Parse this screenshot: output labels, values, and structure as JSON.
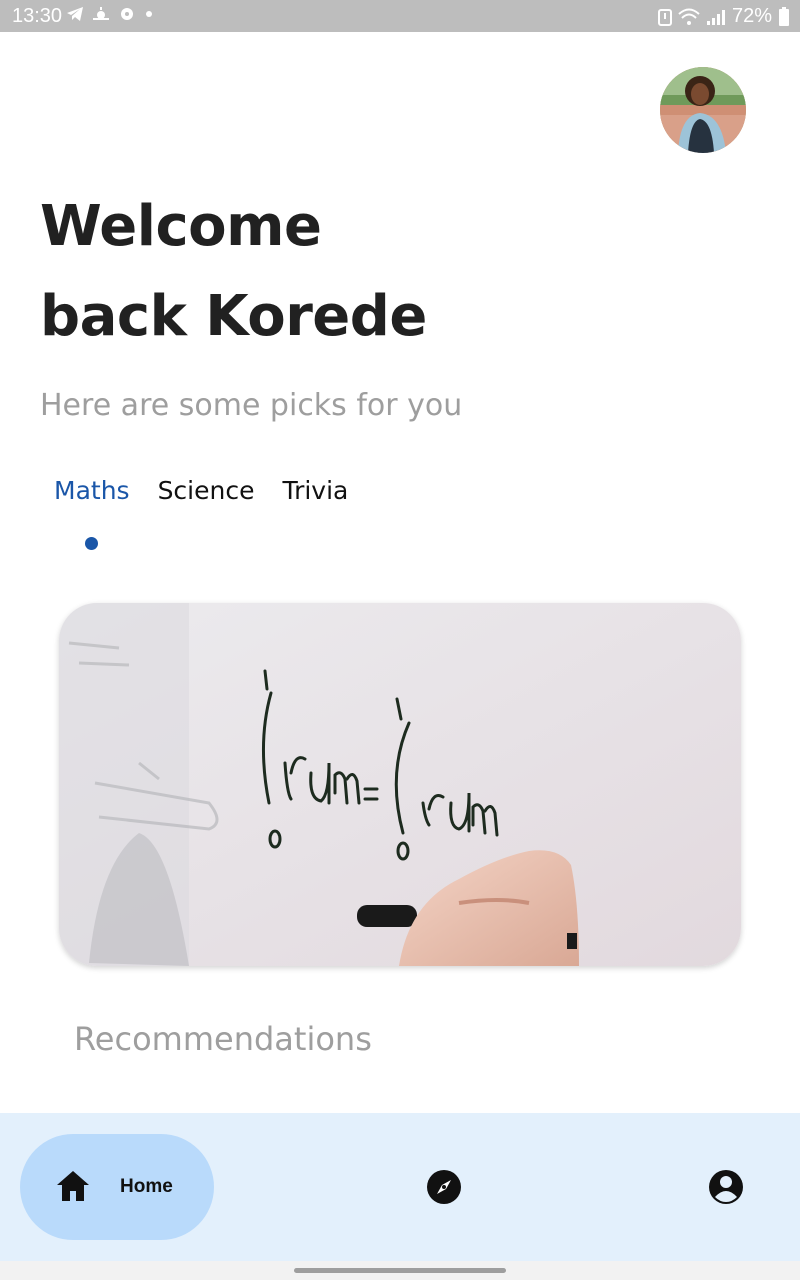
{
  "status_bar": {
    "time": "13:30",
    "battery": "72%",
    "icons": [
      "telegram-icon",
      "weather-icon",
      "gear-icon",
      "dot-icon",
      "alert-icon",
      "wifi-icon",
      "signal-icon",
      "battery-icon"
    ]
  },
  "header": {
    "welcome_line1": "Welcome",
    "welcome_line2": "back Korede",
    "subtitle": "Here are some picks for you"
  },
  "tabs": [
    {
      "label": "Maths",
      "active": true
    },
    {
      "label": "Science",
      "active": false
    },
    {
      "label": "Trivia",
      "active": false
    }
  ],
  "colors": {
    "accent": "#1a56a8",
    "heading": "#212121",
    "muted": "#9e9e9e",
    "nav_bg": "#e3f0fc",
    "nav_active": "#b9dafb"
  },
  "sections": {
    "recommendations": "Recommendations"
  },
  "bottom_nav": {
    "items": [
      {
        "label": "Home",
        "icon": "home-icon",
        "active": true
      },
      {
        "label": "",
        "icon": "compass-icon",
        "active": false
      },
      {
        "label": "",
        "icon": "account-icon",
        "active": false
      }
    ]
  }
}
